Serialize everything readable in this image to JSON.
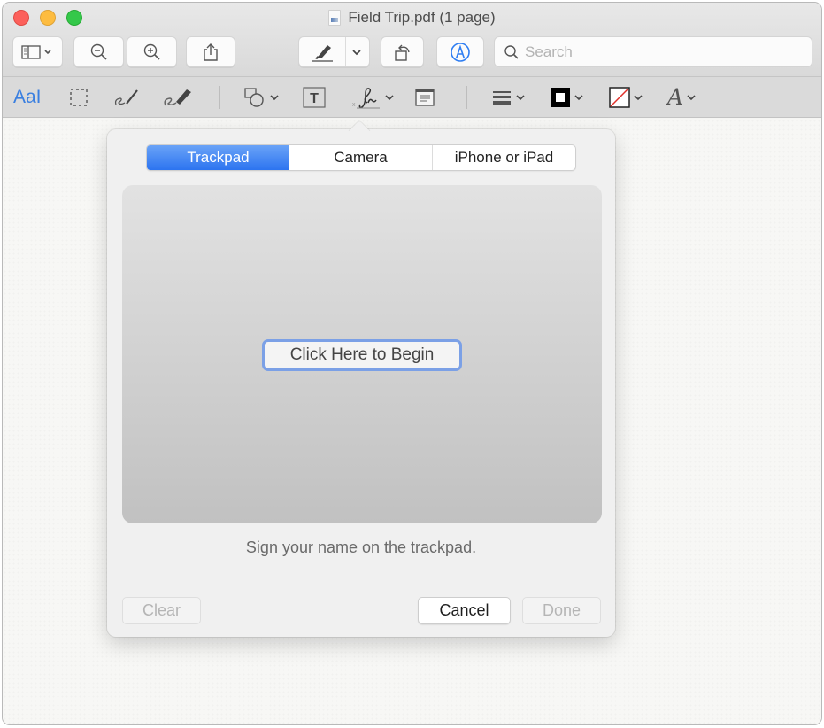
{
  "window": {
    "title": "Field Trip.pdf (1 page)"
  },
  "toolbar": {
    "sidebar_button": "sidebar-view",
    "zoom_out": "zoom-out",
    "zoom_in": "zoom-in",
    "share": "share",
    "highlight": "highlight",
    "rotate": "rotate-left",
    "markup": "markup",
    "search_placeholder": "Search",
    "search_value": ""
  },
  "markup_bar": {
    "text_selection_label": "AaI",
    "tools": [
      "text-selection",
      "rectangular-selection",
      "sketch",
      "draw",
      "shapes",
      "text",
      "sign",
      "note",
      "shape-style",
      "border-color",
      "fill-color",
      "text-style"
    ],
    "text_style_label": "A"
  },
  "popover": {
    "tabs": [
      {
        "label": "Trackpad",
        "active": true
      },
      {
        "label": "Camera",
        "active": false
      },
      {
        "label": "iPhone or iPad",
        "active": false
      }
    ],
    "begin_button": "Click Here to Begin",
    "hint": "Sign your name on the trackpad.",
    "buttons": {
      "clear": "Clear",
      "cancel": "Cancel",
      "done": "Done"
    }
  },
  "colors": {
    "accent": "#2c74f0",
    "focus_ring": "#7ba0e6",
    "close": "#fc605b",
    "minimize": "#fdbc40",
    "maximize": "#34c84a",
    "fill_none_slash": "#e0302a"
  }
}
